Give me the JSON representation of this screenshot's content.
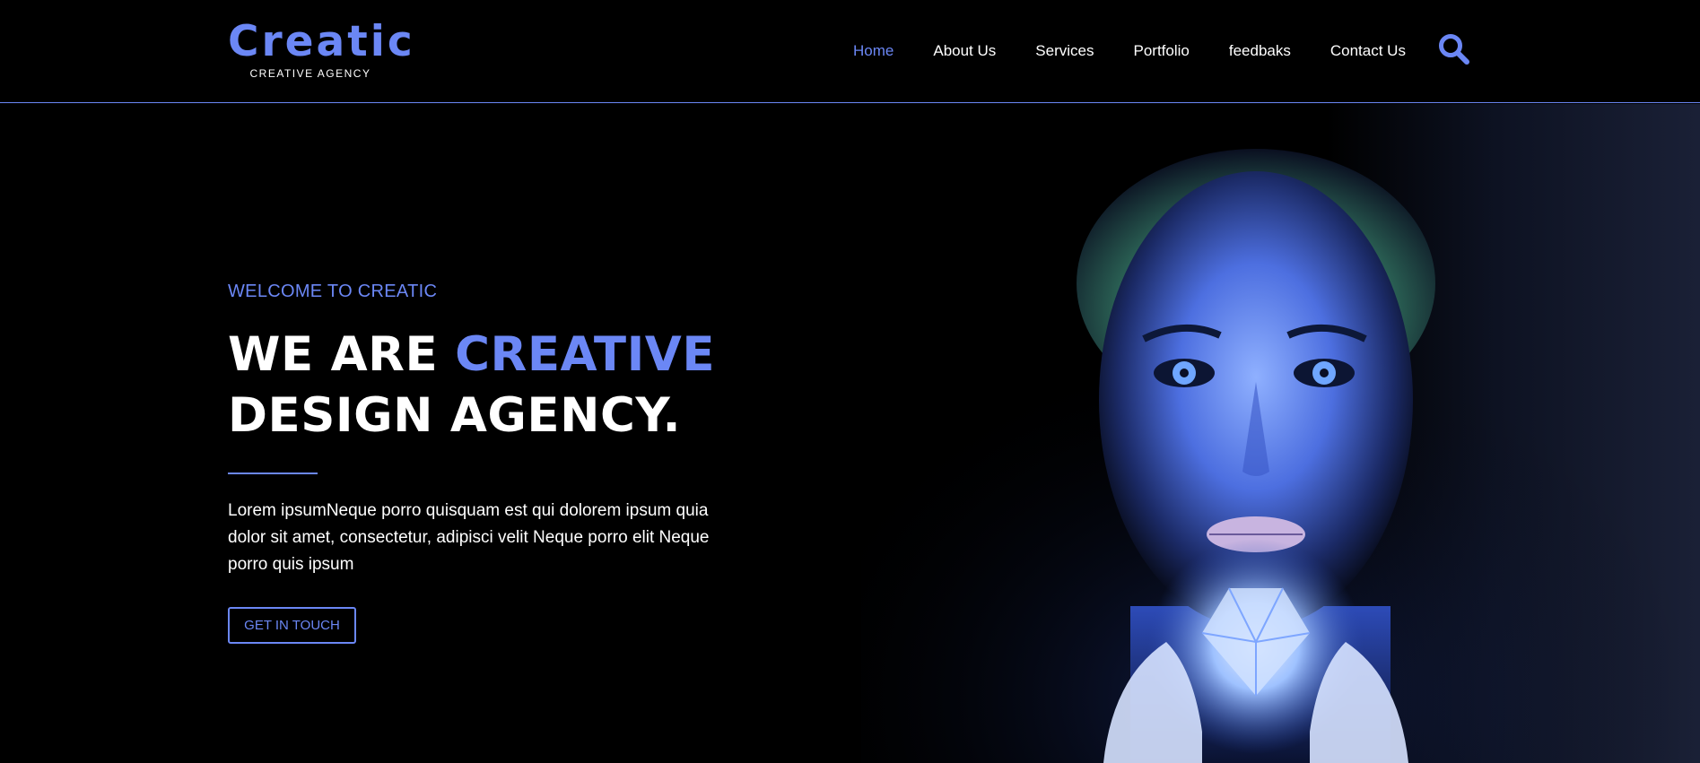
{
  "colors": {
    "accent": "#6b87f5",
    "background": "#000000",
    "text": "#ffffff"
  },
  "logo": {
    "title": "Creatic",
    "subtitle": "CREATIVE AGENCY"
  },
  "nav": {
    "items": [
      {
        "label": "Home",
        "active": true
      },
      {
        "label": "About Us"
      },
      {
        "label": "Services"
      },
      {
        "label": "Portfolio"
      },
      {
        "label": "feedbaks"
      },
      {
        "label": "Contact Us"
      }
    ],
    "search_icon": "search-icon"
  },
  "hero": {
    "welcome": "WELCOME TO CREATIC",
    "headline_part1": "WE ARE ",
    "headline_accent": "CREATIVE",
    "headline_line2": "DESIGN AGENCY.",
    "body": "Lorem ipsumNeque porro quisquam est qui dolorem ipsum quia dolor sit amet, consectetur, adipisci velit Neque porro elit Neque porro quis ipsum",
    "cta_label": "GET IN TOUCH"
  }
}
